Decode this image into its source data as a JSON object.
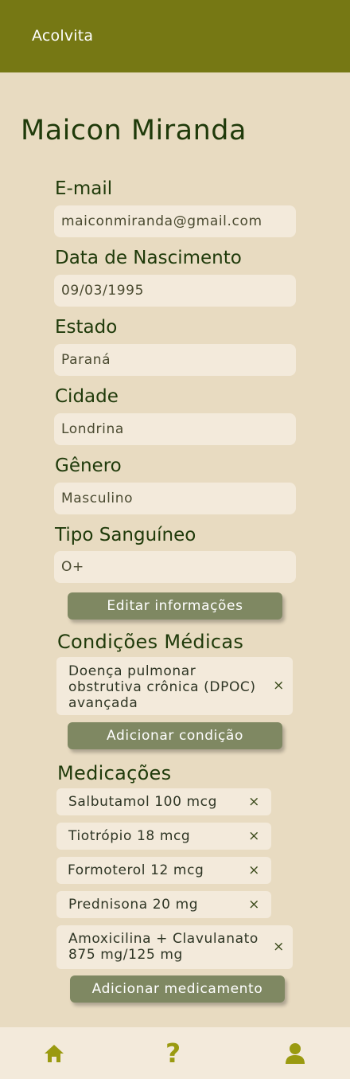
{
  "header": {
    "title": "Acolvita"
  },
  "profile": {
    "name": "Maicon Miranda",
    "fields": [
      {
        "label": "E-mail",
        "value": "maiconmiranda@gmail.com"
      },
      {
        "label": "Data de Nascimento",
        "value": "09/03/1995"
      },
      {
        "label": "Estado",
        "value": "Paraná"
      },
      {
        "label": "Cidade",
        "value": "Londrina"
      },
      {
        "label": "Gênero",
        "value": "Masculino"
      },
      {
        "label": "Tipo Sanguíneo",
        "value": "O+"
      }
    ],
    "edit_button": "Editar informações"
  },
  "conditions": {
    "title": "Condições Médicas",
    "items": [
      {
        "line1": "Doença pulmonar",
        "line2": "obstrutiva crônica (DPOC)",
        "line3": "avançada"
      }
    ],
    "remove_glyph": "×",
    "add_button": "Adicionar condição"
  },
  "medications": {
    "title": "Medicações",
    "items": [
      {
        "line1": "Salbutamol 100 mcg"
      },
      {
        "line1": "Tiotrópio 18 mcg"
      },
      {
        "line1": "Formoterol 12 mcg"
      },
      {
        "line1": "Prednisona 20 mg"
      },
      {
        "line1": "Amoxicilina + Clavulanato",
        "line2": "875 mg/125 mg"
      }
    ],
    "remove_glyph": "×",
    "add_button": "Adicionar medicamento"
  },
  "bottom_nav": {
    "icons": [
      "home-icon",
      "help-icon",
      "user-icon"
    ],
    "help_glyph": "?",
    "icon_color": "#9a9a10"
  },
  "colors": {
    "header": "#767814",
    "background": "#e8dbc1",
    "field": "#f3eadb",
    "button": "#7f8862",
    "text": "#1f3a0a"
  }
}
